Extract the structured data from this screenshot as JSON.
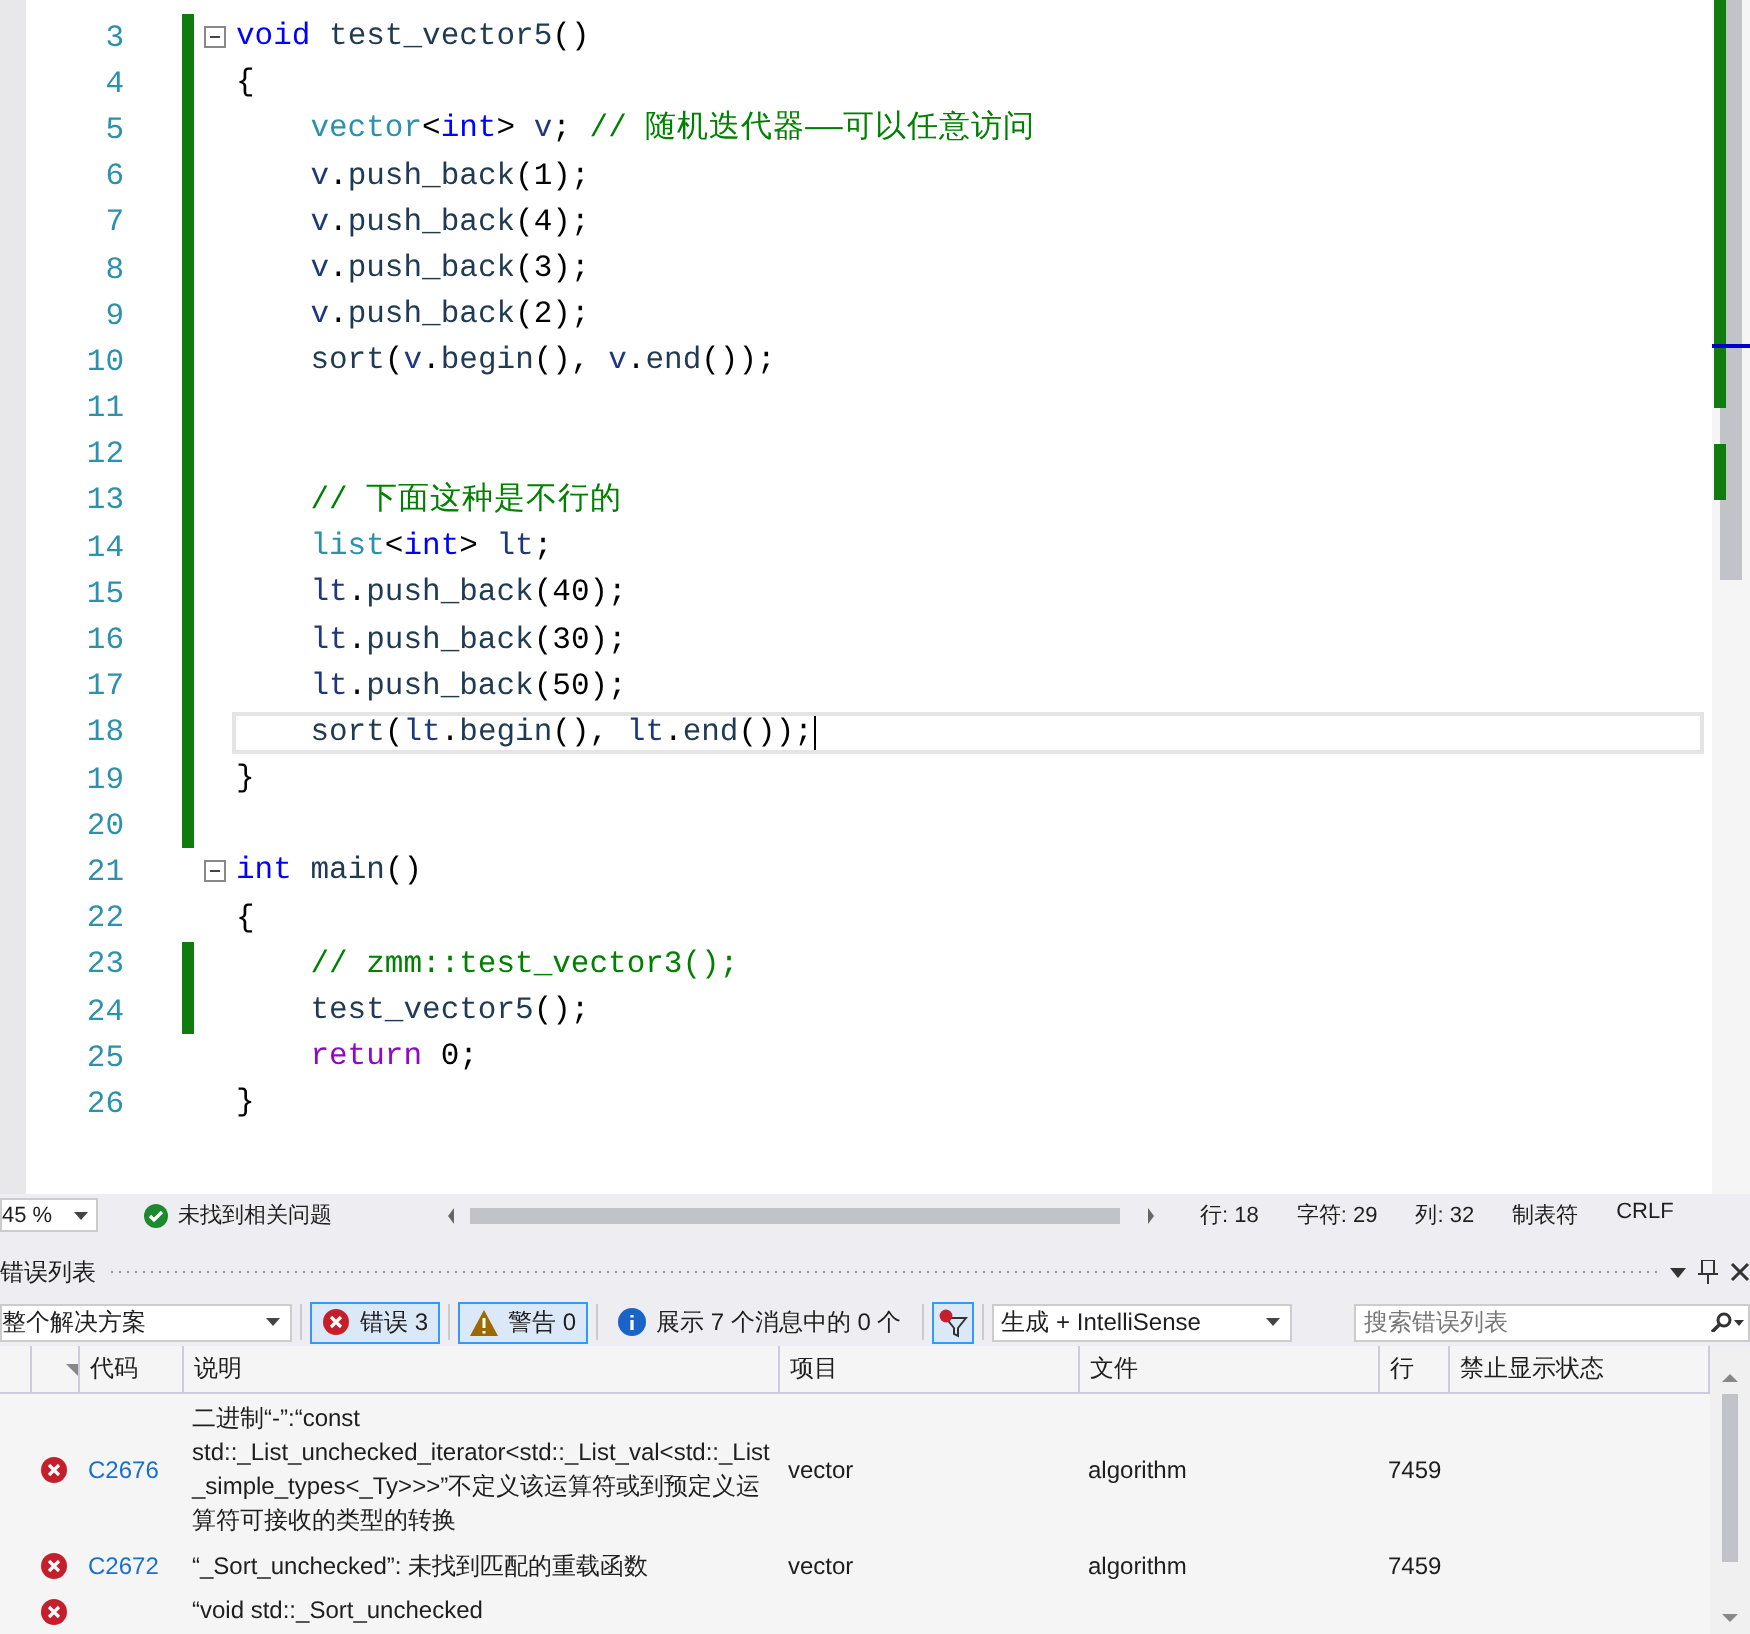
{
  "editor": {
    "lines": [
      {
        "number": "3",
        "changed": true,
        "fold": true,
        "current": false,
        "indented": false,
        "tokens": [
          {
            "kind": "kw",
            "text": "void "
          },
          {
            "kind": "func",
            "text": "test_vector5"
          },
          {
            "kind": "plain",
            "text": "()"
          }
        ]
      },
      {
        "number": "4",
        "changed": true,
        "fold": false,
        "current": false,
        "indented": false,
        "tokens": [
          {
            "kind": "plain",
            "text": "{"
          }
        ]
      },
      {
        "number": "5",
        "changed": true,
        "fold": false,
        "current": false,
        "indented": true,
        "tokens": [
          {
            "kind": "type",
            "text": "vector"
          },
          {
            "kind": "plain",
            "text": "<"
          },
          {
            "kind": "kw",
            "text": "int"
          },
          {
            "kind": "plain",
            "text": "> "
          },
          {
            "kind": "var",
            "text": "v"
          },
          {
            "kind": "plain",
            "text": "; "
          },
          {
            "kind": "comment",
            "text": "// 随机迭代器——可以任意访问"
          }
        ]
      },
      {
        "number": "6",
        "changed": true,
        "fold": false,
        "current": false,
        "indented": true,
        "tokens": [
          {
            "kind": "var",
            "text": "v"
          },
          {
            "kind": "plain",
            "text": "."
          },
          {
            "kind": "func",
            "text": "push_back"
          },
          {
            "kind": "plain",
            "text": "(1);"
          }
        ]
      },
      {
        "number": "7",
        "changed": true,
        "fold": false,
        "current": false,
        "indented": true,
        "tokens": [
          {
            "kind": "var",
            "text": "v"
          },
          {
            "kind": "plain",
            "text": "."
          },
          {
            "kind": "func",
            "text": "push_back"
          },
          {
            "kind": "plain",
            "text": "(4);"
          }
        ]
      },
      {
        "number": "8",
        "changed": true,
        "fold": false,
        "current": false,
        "indented": true,
        "tokens": [
          {
            "kind": "var",
            "text": "v"
          },
          {
            "kind": "plain",
            "text": "."
          },
          {
            "kind": "func",
            "text": "push_back"
          },
          {
            "kind": "plain",
            "text": "(3);"
          }
        ]
      },
      {
        "number": "9",
        "changed": true,
        "fold": false,
        "current": false,
        "indented": true,
        "tokens": [
          {
            "kind": "var",
            "text": "v"
          },
          {
            "kind": "plain",
            "text": "."
          },
          {
            "kind": "func",
            "text": "push_back"
          },
          {
            "kind": "plain",
            "text": "(2);"
          }
        ]
      },
      {
        "number": "10",
        "changed": true,
        "fold": false,
        "current": false,
        "indented": true,
        "tokens": [
          {
            "kind": "func",
            "text": "sort"
          },
          {
            "kind": "plain",
            "text": "("
          },
          {
            "kind": "var",
            "text": "v"
          },
          {
            "kind": "plain",
            "text": "."
          },
          {
            "kind": "func",
            "text": "begin"
          },
          {
            "kind": "plain",
            "text": "(), "
          },
          {
            "kind": "var",
            "text": "v"
          },
          {
            "kind": "plain",
            "text": "."
          },
          {
            "kind": "func",
            "text": "end"
          },
          {
            "kind": "plain",
            "text": "());"
          }
        ]
      },
      {
        "number": "11",
        "changed": true,
        "fold": false,
        "current": false,
        "indented": false
      },
      {
        "number": "12",
        "changed": true,
        "fold": false,
        "current": false,
        "indented": false
      },
      {
        "number": "13",
        "changed": true,
        "fold": false,
        "current": false,
        "indented": true,
        "tokens": [
          {
            "kind": "comment",
            "text": "// 下面这种是不行的"
          }
        ]
      },
      {
        "number": "14",
        "changed": true,
        "fold": false,
        "current": false,
        "indented": true,
        "tokens": [
          {
            "kind": "type",
            "text": "list"
          },
          {
            "kind": "plain",
            "text": "<"
          },
          {
            "kind": "kw",
            "text": "int"
          },
          {
            "kind": "plain",
            "text": "> "
          },
          {
            "kind": "var",
            "text": "lt"
          },
          {
            "kind": "plain",
            "text": ";"
          }
        ]
      },
      {
        "number": "15",
        "changed": true,
        "fold": false,
        "current": false,
        "indented": true,
        "tokens": [
          {
            "kind": "var",
            "text": "lt"
          },
          {
            "kind": "plain",
            "text": "."
          },
          {
            "kind": "func",
            "text": "push_back"
          },
          {
            "kind": "plain",
            "text": "(40);"
          }
        ]
      },
      {
        "number": "16",
        "changed": true,
        "fold": false,
        "current": false,
        "indented": true,
        "tokens": [
          {
            "kind": "var",
            "text": "lt"
          },
          {
            "kind": "plain",
            "text": "."
          },
          {
            "kind": "func",
            "text": "push_back"
          },
          {
            "kind": "plain",
            "text": "(30);"
          }
        ]
      },
      {
        "number": "17",
        "changed": true,
        "fold": false,
        "current": false,
        "indented": true,
        "tokens": [
          {
            "kind": "var",
            "text": "lt"
          },
          {
            "kind": "plain",
            "text": "."
          },
          {
            "kind": "func",
            "text": "push_back"
          },
          {
            "kind": "plain",
            "text": "(50);"
          }
        ]
      },
      {
        "number": "18",
        "changed": true,
        "fold": false,
        "current": true,
        "indented": true,
        "tokens": [
          {
            "kind": "func",
            "text": "sort"
          },
          {
            "kind": "plain",
            "text": "("
          },
          {
            "kind": "var",
            "text": "lt"
          },
          {
            "kind": "plain",
            "text": "."
          },
          {
            "kind": "func",
            "text": "begin"
          },
          {
            "kind": "plain",
            "text": "(), "
          },
          {
            "kind": "var",
            "text": "lt"
          },
          {
            "kind": "plain",
            "text": "."
          },
          {
            "kind": "func",
            "text": "end"
          },
          {
            "kind": "plain",
            "text": "());"
          }
        ]
      },
      {
        "number": "19",
        "changed": true,
        "fold": false,
        "current": false,
        "indented": false,
        "tokens": [
          {
            "kind": "plain",
            "text": "}"
          }
        ]
      },
      {
        "number": "20",
        "changed": true,
        "fold": false,
        "current": false,
        "indented": false
      },
      {
        "number": "21",
        "changed": false,
        "fold": true,
        "current": false,
        "indented": false,
        "tokens": [
          {
            "kind": "kw",
            "text": "int "
          },
          {
            "kind": "func",
            "text": "main"
          },
          {
            "kind": "plain",
            "text": "()"
          }
        ]
      },
      {
        "number": "22",
        "changed": false,
        "fold": false,
        "current": false,
        "indented": false,
        "tokens": [
          {
            "kind": "plain",
            "text": "{"
          }
        ]
      },
      {
        "number": "23",
        "changed": true,
        "fold": false,
        "current": false,
        "indented": true,
        "tokens": [
          {
            "kind": "comment",
            "text": "// zmm::test_vector3();"
          }
        ]
      },
      {
        "number": "24",
        "changed": true,
        "fold": false,
        "current": false,
        "indented": true,
        "tokens": [
          {
            "kind": "func",
            "text": "test_vector5"
          },
          {
            "kind": "plain",
            "text": "();"
          }
        ]
      },
      {
        "number": "25",
        "changed": false,
        "fold": false,
        "current": false,
        "indented": true,
        "tokens": [
          {
            "kind": "ctrl",
            "text": "return"
          },
          {
            "kind": "plain",
            "text": " 0;"
          }
        ]
      },
      {
        "number": "26",
        "changed": false,
        "fold": false,
        "current": false,
        "indented": false,
        "tokens": [
          {
            "kind": "plain",
            "text": "}"
          }
        ]
      }
    ]
  },
  "status_bar": {
    "zoom": "45 %",
    "issues": "未找到相关问题",
    "stats": [
      "行: 18",
      "字符: 29",
      "列: 32",
      "制表符",
      "CRLF"
    ]
  },
  "error_list": {
    "title": "错误列表",
    "scope": "整个解决方案",
    "filters": [
      {
        "kind": "error",
        "label": "错误 3",
        "selected": true
      },
      {
        "kind": "warning",
        "label": "警告 0",
        "selected": true
      },
      {
        "kind": "info",
        "label": "展示 7 个消息中的 0 个",
        "selected": false
      }
    ],
    "filter_toggle": {
      "selected": true
    },
    "source": "生成 + IntelliSense",
    "search": {
      "placeholder": "搜索错误列表"
    },
    "columns": [
      "代码",
      "说明",
      "项目",
      "文件",
      "行",
      "禁止显示状态"
    ],
    "rows": [
      {
        "code": "C2676",
        "description": "二进制“-”:“const std::_List_unchecked_iterator<std::_List_val<std::_List_simple_types<_Ty>>>”不定义该运算符或到预定义运算符可接收的类型的转换",
        "project": "vector",
        "file": "algorithm",
        "line": "7459"
      },
      {
        "code": "C2672",
        "description": "“_Sort_unchecked”: 未找到匹配的重载函数",
        "project": "vector",
        "file": "algorithm",
        "line": "7459"
      },
      {
        "description": "“void std::_Sort_unchecked"
      }
    ]
  }
}
